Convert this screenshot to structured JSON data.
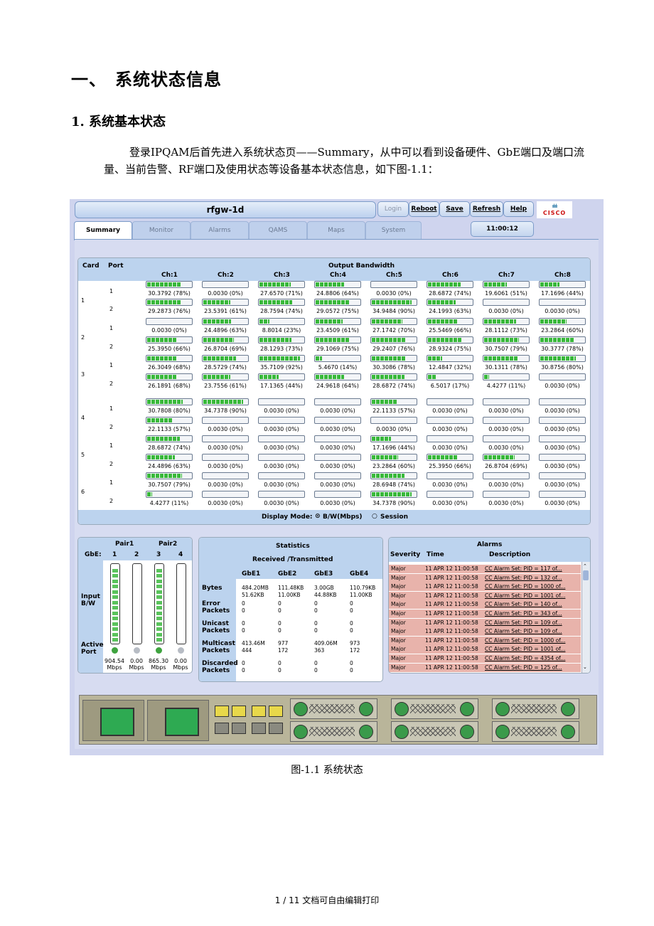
{
  "doc": {
    "h1_num": "一、",
    "h1_title": "系统状态信息",
    "h2": "1. 系统基本状态",
    "paragraph": "登录IPQAM后首先进入系统状态页——Summary，从中可以看到设备硬件、GbE端口及端口流量、当前告警、RF端口及使用状态等设备基本状态信息，如下图-1.1：",
    "caption": "图-1.1 系统状态",
    "footer": "1 / 11 文档可自由编辑打印"
  },
  "ui": {
    "title": "rfgw-1d",
    "buttons": [
      "Login",
      "Reboot",
      "Save",
      "Refresh",
      "Help"
    ],
    "logo_text": "CISCO",
    "tabs": [
      "Summary",
      "Monitor",
      "Alarms",
      "QAMS",
      "Maps",
      "System"
    ],
    "clock": "11:00:12",
    "bandwidth": {
      "card_label": "Card",
      "port_label": "Port",
      "title": "Output Bandwidth",
      "channels": [
        "Ch:1",
        "Ch:2",
        "Ch:3",
        "Ch:4",
        "Ch:5",
        "Ch:6",
        "Ch:7",
        "Ch:8"
      ],
      "cards": [
        "1",
        "2",
        "3",
        "4",
        "5",
        "6"
      ],
      "rows": [
        {
          "port": "1",
          "values": [
            "30.3792 (78%)",
            "0.0030 (0%)",
            "27.6570 (71%)",
            "24.8806 (64%)",
            "0.0030 (0%)",
            "28.6872 (74%)",
            "19.6061 (51%)",
            "17.1696 (44%)"
          ],
          "pct": [
            78,
            0,
            71,
            64,
            0,
            74,
            51,
            44
          ]
        },
        {
          "port": "2",
          "values": [
            "29.2873 (76%)",
            "23.5391 (61%)",
            "28.7594 (74%)",
            "29.0572 (75%)",
            "34.9484 (90%)",
            "24.1993 (63%)",
            "0.0030 (0%)",
            "0.0030 (0%)"
          ],
          "pct": [
            76,
            61,
            74,
            75,
            90,
            63,
            0,
            0
          ]
        },
        {
          "port": "1",
          "values": [
            "0.0030 (0%)",
            "24.4896 (63%)",
            "8.8014 (23%)",
            "23.4509 (61%)",
            "27.1742 (70%)",
            "25.5469 (66%)",
            "28.1112 (73%)",
            "23.2864 (60%)"
          ],
          "pct": [
            0,
            63,
            23,
            61,
            70,
            66,
            73,
            60
          ]
        },
        {
          "port": "2",
          "values": [
            "25.3950 (66%)",
            "26.8704 (69%)",
            "28.1293 (73%)",
            "29.1069 (75%)",
            "29.2407 (76%)",
            "28.9324 (75%)",
            "30.7507 (79%)",
            "30.3777 (78%)"
          ],
          "pct": [
            66,
            69,
            73,
            75,
            76,
            75,
            79,
            78
          ]
        },
        {
          "port": "1",
          "values": [
            "26.3049 (68%)",
            "28.5729 (74%)",
            "35.7109 (92%)",
            "5.4670 (14%)",
            "30.3086 (78%)",
            "12.4847 (32%)",
            "30.1311 (78%)",
            "30.8756 (80%)"
          ],
          "pct": [
            68,
            74,
            92,
            14,
            78,
            32,
            78,
            80
          ]
        },
        {
          "port": "2",
          "values": [
            "26.1891 (68%)",
            "23.7556 (61%)",
            "17.1365 (44%)",
            "24.9618 (64%)",
            "28.6872 (74%)",
            "6.5017 (17%)",
            "4.4277 (11%)",
            "0.0030 (0%)"
          ],
          "pct": [
            68,
            61,
            44,
            64,
            74,
            17,
            11,
            0
          ]
        },
        {
          "port": "1",
          "values": [
            "30.7808 (80%)",
            "34.7378 (90%)",
            "0.0030 (0%)",
            "0.0030 (0%)",
            "22.1133 (57%)",
            "0.0030 (0%)",
            "0.0030 (0%)",
            "0.0030 (0%)"
          ],
          "pct": [
            80,
            90,
            0,
            0,
            57,
            0,
            0,
            0
          ]
        },
        {
          "port": "2",
          "values": [
            "22.1133 (57%)",
            "0.0030 (0%)",
            "0.0030 (0%)",
            "0.0030 (0%)",
            "0.0030 (0%)",
            "0.0030 (0%)",
            "0.0030 (0%)",
            "0.0030 (0%)"
          ],
          "pct": [
            57,
            0,
            0,
            0,
            0,
            0,
            0,
            0
          ]
        },
        {
          "port": "1",
          "values": [
            "28.6872 (74%)",
            "0.0030 (0%)",
            "0.0030 (0%)",
            "0.0030 (0%)",
            "17.1696 (44%)",
            "0.0030 (0%)",
            "0.0030 (0%)",
            "0.0030 (0%)"
          ],
          "pct": [
            74,
            0,
            0,
            0,
            44,
            0,
            0,
            0
          ]
        },
        {
          "port": "2",
          "values": [
            "24.4896 (63%)",
            "0.0030 (0%)",
            "0.0030 (0%)",
            "0.0030 (0%)",
            "23.2864 (60%)",
            "25.3950 (66%)",
            "26.8704 (69%)",
            "0.0030 (0%)"
          ],
          "pct": [
            63,
            0,
            0,
            0,
            60,
            66,
            69,
            0
          ]
        },
        {
          "port": "1",
          "values": [
            "30.7507 (79%)",
            "0.0030 (0%)",
            "0.0030 (0%)",
            "0.0030 (0%)",
            "28.6948 (74%)",
            "0.0030 (0%)",
            "0.0030 (0%)",
            "0.0030 (0%)"
          ],
          "pct": [
            79,
            0,
            0,
            0,
            74,
            0,
            0,
            0
          ]
        },
        {
          "port": "2",
          "values": [
            "4.4277 (11%)",
            "0.0030 (0%)",
            "0.0030 (0%)",
            "0.0030 (0%)",
            "34.7378 (90%)",
            "0.0030 (0%)",
            "0.0030 (0%)",
            "0.0030 (0%)"
          ],
          "pct": [
            11,
            0,
            0,
            0,
            90,
            0,
            0,
            0
          ]
        }
      ],
      "display_mode_label": "Display Mode:",
      "mode_bw": "B/W(Mbps)",
      "mode_session": "Session",
      "selected_mode": "B/W(Mbps)"
    },
    "gbe": {
      "pair1": "Pair1",
      "pair2": "Pair2",
      "gbe_label": "GbE:",
      "ports": [
        "1",
        "2",
        "3",
        "4"
      ],
      "input_label": "Input B/W",
      "active_label": "Active Port",
      "levels": [
        100,
        0,
        100,
        0
      ],
      "active": [
        true,
        false,
        true,
        false
      ],
      "rates": [
        "904.54 Mbps",
        "0.00 Mbps",
        "865.30 Mbps",
        "0.00 Mbps"
      ],
      "colors": {
        "active": "#3fa33f",
        "inactive": "#b7bcc4",
        "meter": "#5ac35c"
      }
    },
    "stats": {
      "title": "Statistics",
      "subtitle": "Received /Transmitted",
      "columns": [
        "GbE1",
        "GbE2",
        "GbE3",
        "GbE4"
      ],
      "rows": [
        {
          "label": "Bytes",
          "values": [
            "484.20MB\n51.62KB",
            "111.48KB\n11.00KB",
            "3.00GB\n44.88KB",
            "110.79KB\n11.00KB"
          ]
        },
        {
          "label": "Error Packets",
          "values": [
            "0\n0",
            "0\n0",
            "0\n0",
            "0\n0"
          ]
        },
        {
          "label": "Unicast Packets",
          "values": [
            "0\n0",
            "0\n0",
            "0\n0",
            "0\n0"
          ]
        },
        {
          "label": "Multicast Packets",
          "values": [
            "413.46M\n444",
            "977\n172",
            "409.06M\n363",
            "973\n172"
          ]
        },
        {
          "label": "Discarded Packets",
          "values": [
            "0\n0",
            "0\n0",
            "0\n0",
            "0\n0"
          ]
        }
      ]
    },
    "alarms": {
      "title": "Alarms",
      "col_severity": "Severity",
      "col_time": "Time",
      "col_description": "Description",
      "rows": [
        {
          "severity": "Major",
          "time": "11 APR 12 11:00:58",
          "desc": "CC Alarm Set: PID = 117 of..."
        },
        {
          "severity": "Major",
          "time": "11 APR 12 11:00:58",
          "desc": "CC Alarm Set: PID = 132 of..."
        },
        {
          "severity": "Major",
          "time": "11 APR 12 11:00:58",
          "desc": "CC Alarm Set: PID = 1000 of..."
        },
        {
          "severity": "Major",
          "time": "11 APR 12 11:00:58",
          "desc": "CC Alarm Set: PID = 1001 of..."
        },
        {
          "severity": "Major",
          "time": "11 APR 12 11:00:58",
          "desc": "CC Alarm Set: PID = 140 of..."
        },
        {
          "severity": "Major",
          "time": "11 APR 12 11:00:58",
          "desc": "CC Alarm Set: PID = 343 of..."
        },
        {
          "severity": "Major",
          "time": "11 APR 12 11:00:58",
          "desc": "CC Alarm Set: PID = 109 of..."
        },
        {
          "severity": "Major",
          "time": "11 APR 12 11:00:58",
          "desc": "CC Alarm Set: PID = 109 of..."
        },
        {
          "severity": "Major",
          "time": "11 APR 12 11:00:58",
          "desc": "CC Alarm Set: PID = 1000 of..."
        },
        {
          "severity": "Major",
          "time": "11 APR 12 11:00:58",
          "desc": "CC Alarm Set: PID = 1001 of..."
        },
        {
          "severity": "Major",
          "time": "11 APR 12 11:00:58",
          "desc": "CC Alarm Set: PID = 4354 of..."
        },
        {
          "severity": "Major",
          "time": "11 APR 12 11:00:58",
          "desc": "CC Alarm Set: PID = 125 of..."
        }
      ]
    }
  }
}
